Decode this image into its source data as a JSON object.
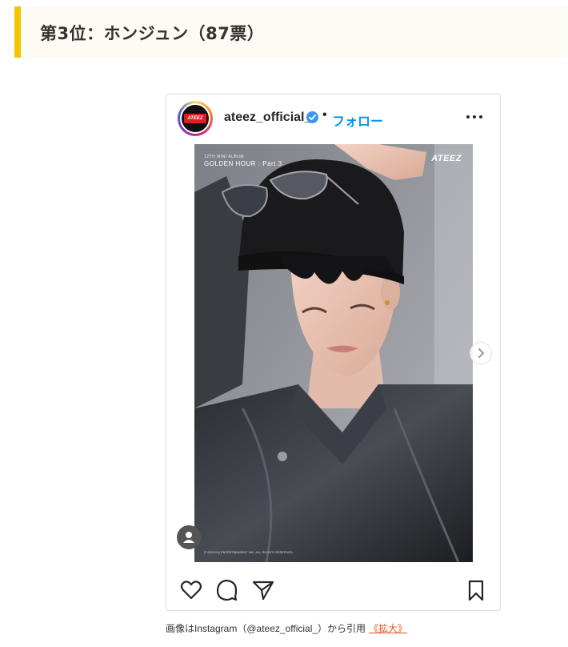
{
  "heading": {
    "title": "第3位：ホンジュン（87票）"
  },
  "post": {
    "username": "ateez_official_",
    "separator": "•",
    "follow_label": "フォロー",
    "avatar_logo": "ATEEZ",
    "photo": {
      "album_small": "12TH MINI ALBUM",
      "album_title": "GOLDEN HOUR : Part.3",
      "brand": "ATEEZ",
      "copyright": "© 2025 KQ ENTERTAINMENT INC. ALL RIGHTS RESERVED."
    },
    "carousel": {
      "count": 2,
      "current": 1
    }
  },
  "caption": {
    "text": "画像はInstagram（@ateez_official_）から引用",
    "enlarge_label": "《拡大》"
  },
  "colors": {
    "heading_accent": "#f2c500",
    "heading_bg": "#fdfbf4",
    "follow": "#0095f6",
    "verified": "#3897f0",
    "link": "#e8541e"
  },
  "icons": [
    "verified-badge-icon",
    "more-options-icon",
    "next-arrow-icon",
    "user-tag-icon",
    "heart-icon",
    "comment-icon",
    "share-icon",
    "bookmark-icon"
  ]
}
